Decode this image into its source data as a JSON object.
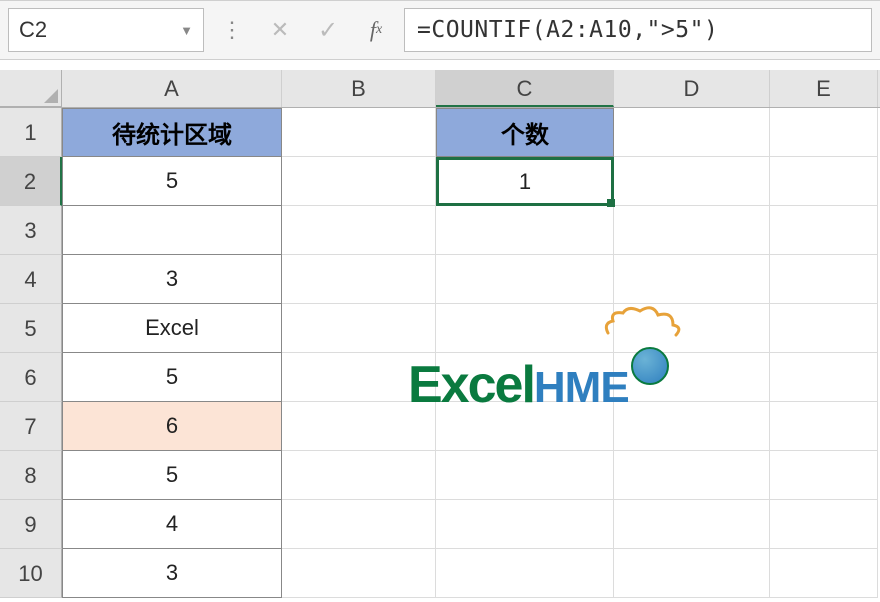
{
  "namebox": "C2",
  "formula": "=COUNTIF(A2:A10,\">5\")",
  "columns": [
    "A",
    "B",
    "C",
    "D",
    "E"
  ],
  "rows": [
    "1",
    "2",
    "3",
    "4",
    "5",
    "6",
    "7",
    "8",
    "9",
    "10"
  ],
  "active_cell": "C2",
  "headers": {
    "A1": "待统计区域",
    "C1": "个数"
  },
  "data": {
    "A2": "5",
    "A3": "",
    "A4": "3",
    "A5": "Excel",
    "A6": "5",
    "A7": "6",
    "A8": "5",
    "A9": "4",
    "A10": "3",
    "C2": "1"
  },
  "highlighted_cell": "A7",
  "logo": {
    "part1": "Excel",
    "part2": "H",
    "part3": "ME"
  }
}
